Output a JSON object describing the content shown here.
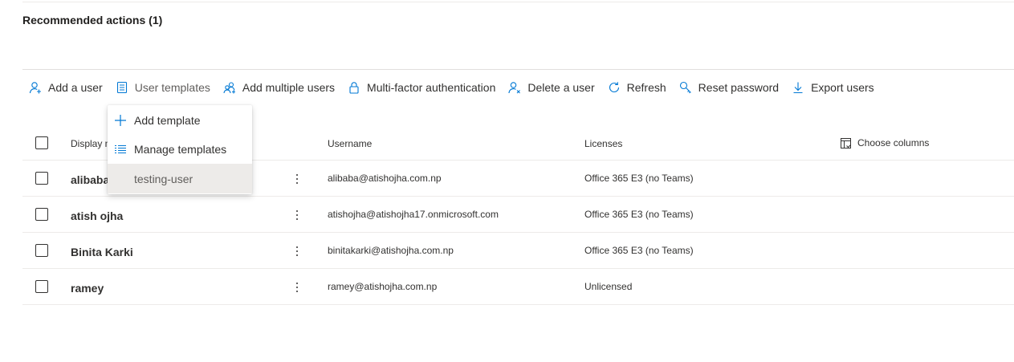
{
  "section": {
    "title": "Recommended actions (1)"
  },
  "commands": [
    {
      "label": "Add a user",
      "icon": "add-user-icon"
    },
    {
      "label": "User templates",
      "icon": "template-icon"
    },
    {
      "label": "Add multiple users",
      "icon": "multiple-users-icon"
    },
    {
      "label": "Multi-factor authentication",
      "icon": "lock-icon"
    },
    {
      "label": "Delete a user",
      "icon": "delete-user-icon"
    },
    {
      "label": "Refresh",
      "icon": "refresh-icon"
    },
    {
      "label": "Reset password",
      "icon": "key-icon"
    },
    {
      "label": "Export users",
      "icon": "download-icon"
    }
  ],
  "templates_menu": {
    "items": [
      {
        "label": "Add template",
        "icon": "plus-icon"
      },
      {
        "label": "Manage templates",
        "icon": "list-icon"
      }
    ],
    "templates": [
      "testing-user"
    ]
  },
  "table": {
    "columns": {
      "display_name": "Display name",
      "username": "Username",
      "licenses": "Licenses",
      "choose_columns": "Choose columns"
    },
    "rows": [
      {
        "display_name": "alibaba",
        "username": "alibaba@atishojha.com.np",
        "licenses": "Office 365 E3 (no Teams)"
      },
      {
        "display_name": "atish ojha",
        "username": "atishojha@atishojha17.onmicrosoft.com",
        "licenses": "Office 365 E3 (no Teams)"
      },
      {
        "display_name": "Binita Karki",
        "username": "binitakarki@atishojha.com.np",
        "licenses": "Office 365 E3 (no Teams)"
      },
      {
        "display_name": "ramey",
        "username": "ramey@atishojha.com.np",
        "licenses": "Unlicensed"
      }
    ]
  },
  "colors": {
    "accent": "#0078d4",
    "text": "#323130",
    "divider": "#edebe9",
    "menu_selected": "#edebe9"
  }
}
